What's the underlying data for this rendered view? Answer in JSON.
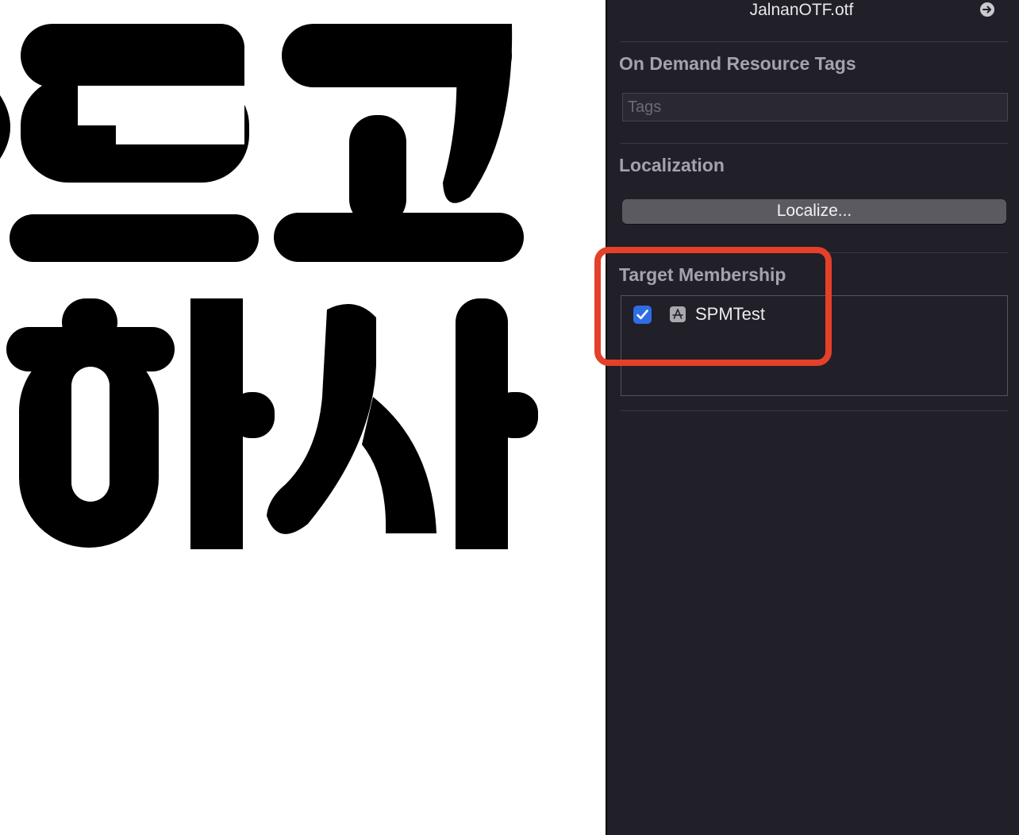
{
  "preview": {
    "glyph_line_1": "르고",
    "glyph_line_2": "하사"
  },
  "inspector": {
    "file_name": "JalnanOTF.otf",
    "reveal_icon": "arrow-circle-right-icon",
    "on_demand_section": {
      "title": "On Demand Resource Tags",
      "tags_placeholder": "Tags"
    },
    "localization_section": {
      "title": "Localization",
      "localize_button": "Localize..."
    },
    "target_membership_section": {
      "title": "Target Membership",
      "targets": [
        {
          "name": "SPMTest",
          "checked": true,
          "icon": "app-store-icon"
        }
      ]
    }
  },
  "annotation": {
    "highlight_color": "#e4402a"
  }
}
